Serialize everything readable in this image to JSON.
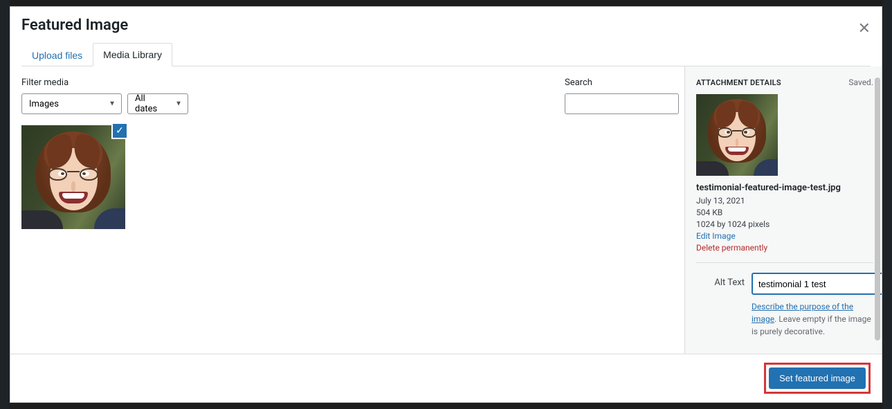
{
  "modal": {
    "title": "Featured Image",
    "close_glyph": "✕"
  },
  "tabs": {
    "upload": "Upload files",
    "library": "Media Library"
  },
  "toolbar": {
    "filter_label": "Filter media",
    "type_filter": "Images",
    "date_filter": "All dates",
    "search_label": "Search",
    "search_value": ""
  },
  "attachment": {
    "check_glyph": "✓"
  },
  "details": {
    "heading": "ATTACHMENT DETAILS",
    "saved": "Saved.",
    "filename": "testimonial-featured-image-test.jpg",
    "date": "July 13, 2021",
    "filesize": "504 KB",
    "dimensions": "1024 by 1024 pixels",
    "edit_label": "Edit Image",
    "delete_label": "Delete permanently"
  },
  "alt": {
    "label": "Alt Text",
    "value": "testimonial 1 test",
    "help_link": "Describe the purpose of the image",
    "help_rest": ". Leave empty if the image is purely decorative."
  },
  "footer": {
    "set_label": "Set featured image"
  }
}
